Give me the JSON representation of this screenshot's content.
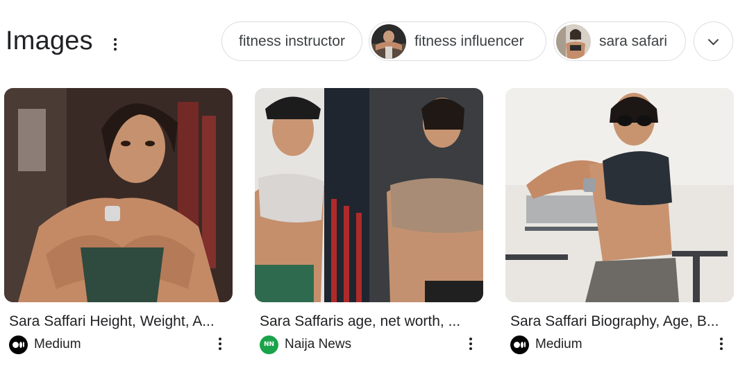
{
  "header": {
    "title": "Images"
  },
  "chips": [
    {
      "label": "fitness instructor"
    },
    {
      "label": "fitness influencer"
    },
    {
      "label": "sara safari"
    }
  ],
  "results": [
    {
      "caption": "Sara Saffari Height, Weight, A...",
      "source": "Medium",
      "favicon": "medium-logo-icon"
    },
    {
      "caption": "Sara Saffaris age, net worth, ...",
      "source": "Naija News",
      "favicon": "naija-news-logo-icon",
      "favicon_text": "NN"
    },
    {
      "caption": "Sara Saffari Biography, Age, B...",
      "source": "Medium",
      "favicon": "medium-logo-icon"
    }
  ],
  "colors": {
    "text": "#202124",
    "chip_border": "#dadce0",
    "naija_green": "#1aa34a"
  }
}
